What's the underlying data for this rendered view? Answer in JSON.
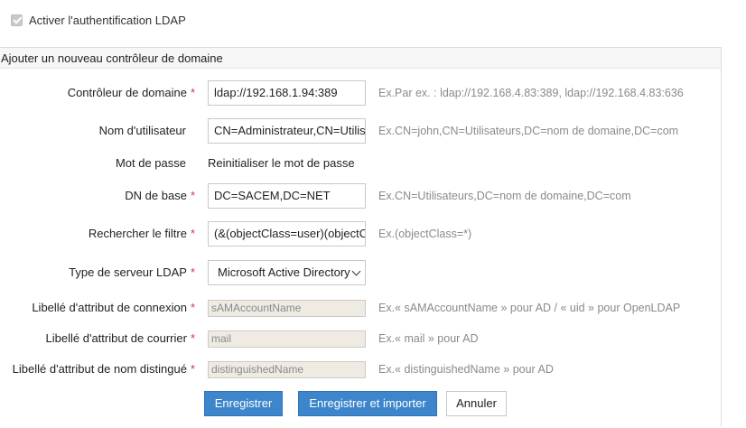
{
  "enable_ldap": {
    "label": "Activer l'authentification LDAP",
    "checked": true
  },
  "panel": {
    "title": "Ajouter un nouveau contrôleur de domaine"
  },
  "fields": [
    {
      "label": "Contrôleur de domaine",
      "required": true,
      "type": "text",
      "value": "ldap://192.168.1.94:389",
      "hint": "Ex.Par ex. : ldap://192.168.4.83:389, ldap://192.168.4.83:636"
    },
    {
      "label": "Nom d'utilisateur",
      "required": false,
      "type": "text",
      "value": "CN=Administrateur,CN=Utilisateurs",
      "hint": "Ex.CN=john,CN=Utilisateurs,DC=nom de domaine,DC=com"
    },
    {
      "label": "Mot de passe",
      "required": false,
      "type": "link",
      "value": "Reinitialiser le mot de passe",
      "hint": ""
    },
    {
      "label": "DN de base",
      "required": true,
      "type": "text",
      "value": "DC=SACEM,DC=NET",
      "hint": "Ex.CN=Utilisateurs,DC=nom de domaine,DC=com"
    },
    {
      "label": "Rechercher le filtre",
      "required": true,
      "type": "text",
      "value": "(&(objectClass=user)(objectCategory=person))",
      "hint": "Ex.(objectClass=*)"
    },
    {
      "label": "Type de serveur LDAP",
      "required": true,
      "type": "select",
      "value": "Microsoft Active Directory",
      "hint": ""
    },
    {
      "label": "Libellé d'attribut de connexion",
      "required": true,
      "type": "readonly",
      "value": "sAMAccountName",
      "hint": "Ex.« sAMAccountName » pour AD / « uid » pour OpenLDAP"
    },
    {
      "label": "Libellé d'attribut de courrier",
      "required": true,
      "type": "readonly",
      "value": "mail",
      "hint": "Ex.« mail » pour AD"
    },
    {
      "label": "Libellé d'attribut de nom distingué",
      "required": true,
      "type": "readonly",
      "value": "distinguishedName",
      "hint": "Ex.« distinguishedName » pour AD"
    }
  ],
  "buttons": {
    "save": "Enregistrer",
    "save_import": "Enregistrer et importer",
    "cancel": "Annuler"
  },
  "colors": {
    "primary": "#3d86cb",
    "required": "#d9333f",
    "readonly_bg": "#efebe3",
    "hint": "#8a8a8a"
  }
}
